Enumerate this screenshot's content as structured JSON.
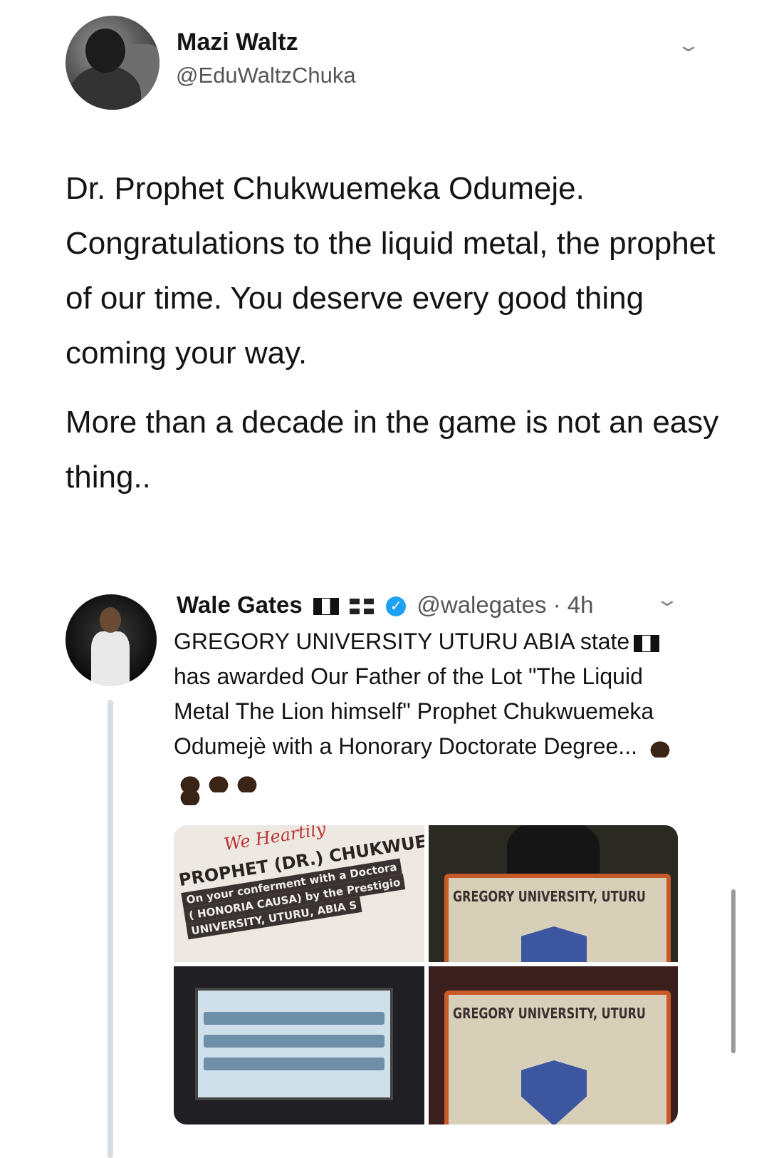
{
  "tweet": {
    "author_name": "Mazi Waltz",
    "author_handle": "@EduWaltzChuka",
    "text_paragraphs": [
      "Dr. Prophet Chukwuemeka Odumeje. Congratulations to the liquid metal, the prophet of our time. You deserve every good thing coming your way.",
      "More than a decade in the game is not an easy thing.."
    ],
    "chevron_icon": "chevron-down-icon"
  },
  "quoted_tweet": {
    "author_name": "Wale Gates",
    "handle_time": "@walegates · 4h",
    "text_part1": "GREGORY UNIVERSITY UTURU ABIA state",
    "text_part2": " has awarded Our Father of the Lot \"The Liquid Metal The Lion himself\" Prophet Chukwuemeka Odumejè with a Honorary Doctorate Degree...",
    "flags": [
      "nigeria-flag-icon",
      "uk-flag-icon"
    ],
    "verified_icon": "verified-badge-icon",
    "emoji": "raising-hands-icon",
    "images": {
      "banner": {
        "script": "We Heartily",
        "line1": "PROPHET (DR.) CHUKWUEMEKA CY",
        "line2": "On your conferment with a Doctora",
        "line3": "( HONORIA CAUSA) by the Prestigio",
        "line4": "UNIVERSITY, UTURU, ABIA S"
      },
      "podium_label_1": "GREGORY UNIVERSITY, UTURU",
      "podium_label_2": "GREGORY UNIVERSITY, UTURU"
    }
  },
  "colors": {
    "verified": "#1da1f2",
    "thread_line": "#d8dde1",
    "handle": "#555555"
  }
}
